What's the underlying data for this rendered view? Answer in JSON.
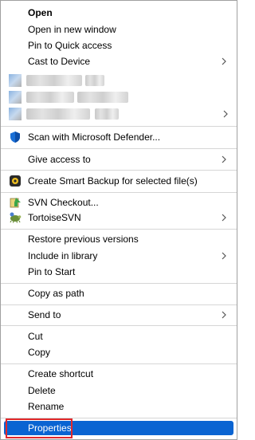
{
  "menu": {
    "items": {
      "open": "Open",
      "open_new_window": "Open in new window",
      "pin_quick_access": "Pin to Quick access",
      "cast_to_device": "Cast to Device",
      "scan_defender": "Scan with Microsoft Defender...",
      "give_access": "Give access to",
      "smart_backup": "Create Smart Backup for selected file(s)",
      "svn_checkout": "SVN Checkout...",
      "tortoise_svn": "TortoiseSVN",
      "restore_previous": "Restore previous versions",
      "include_library": "Include in library",
      "pin_to_start": "Pin to Start",
      "copy_as_path": "Copy as path",
      "send_to": "Send to",
      "cut": "Cut",
      "copy": "Copy",
      "create_shortcut": "Create shortcut",
      "delete": "Delete",
      "rename": "Rename",
      "properties": "Properties"
    },
    "icons": {
      "defender": "shield-icon",
      "backup": "backup-icon",
      "svn_checkout": "svn-checkout-icon",
      "tortoise": "tortoise-icon",
      "chevron": "chevron-right-icon"
    },
    "colors": {
      "selection": "#0a64d2",
      "annotation_border": "#e0282c"
    }
  }
}
